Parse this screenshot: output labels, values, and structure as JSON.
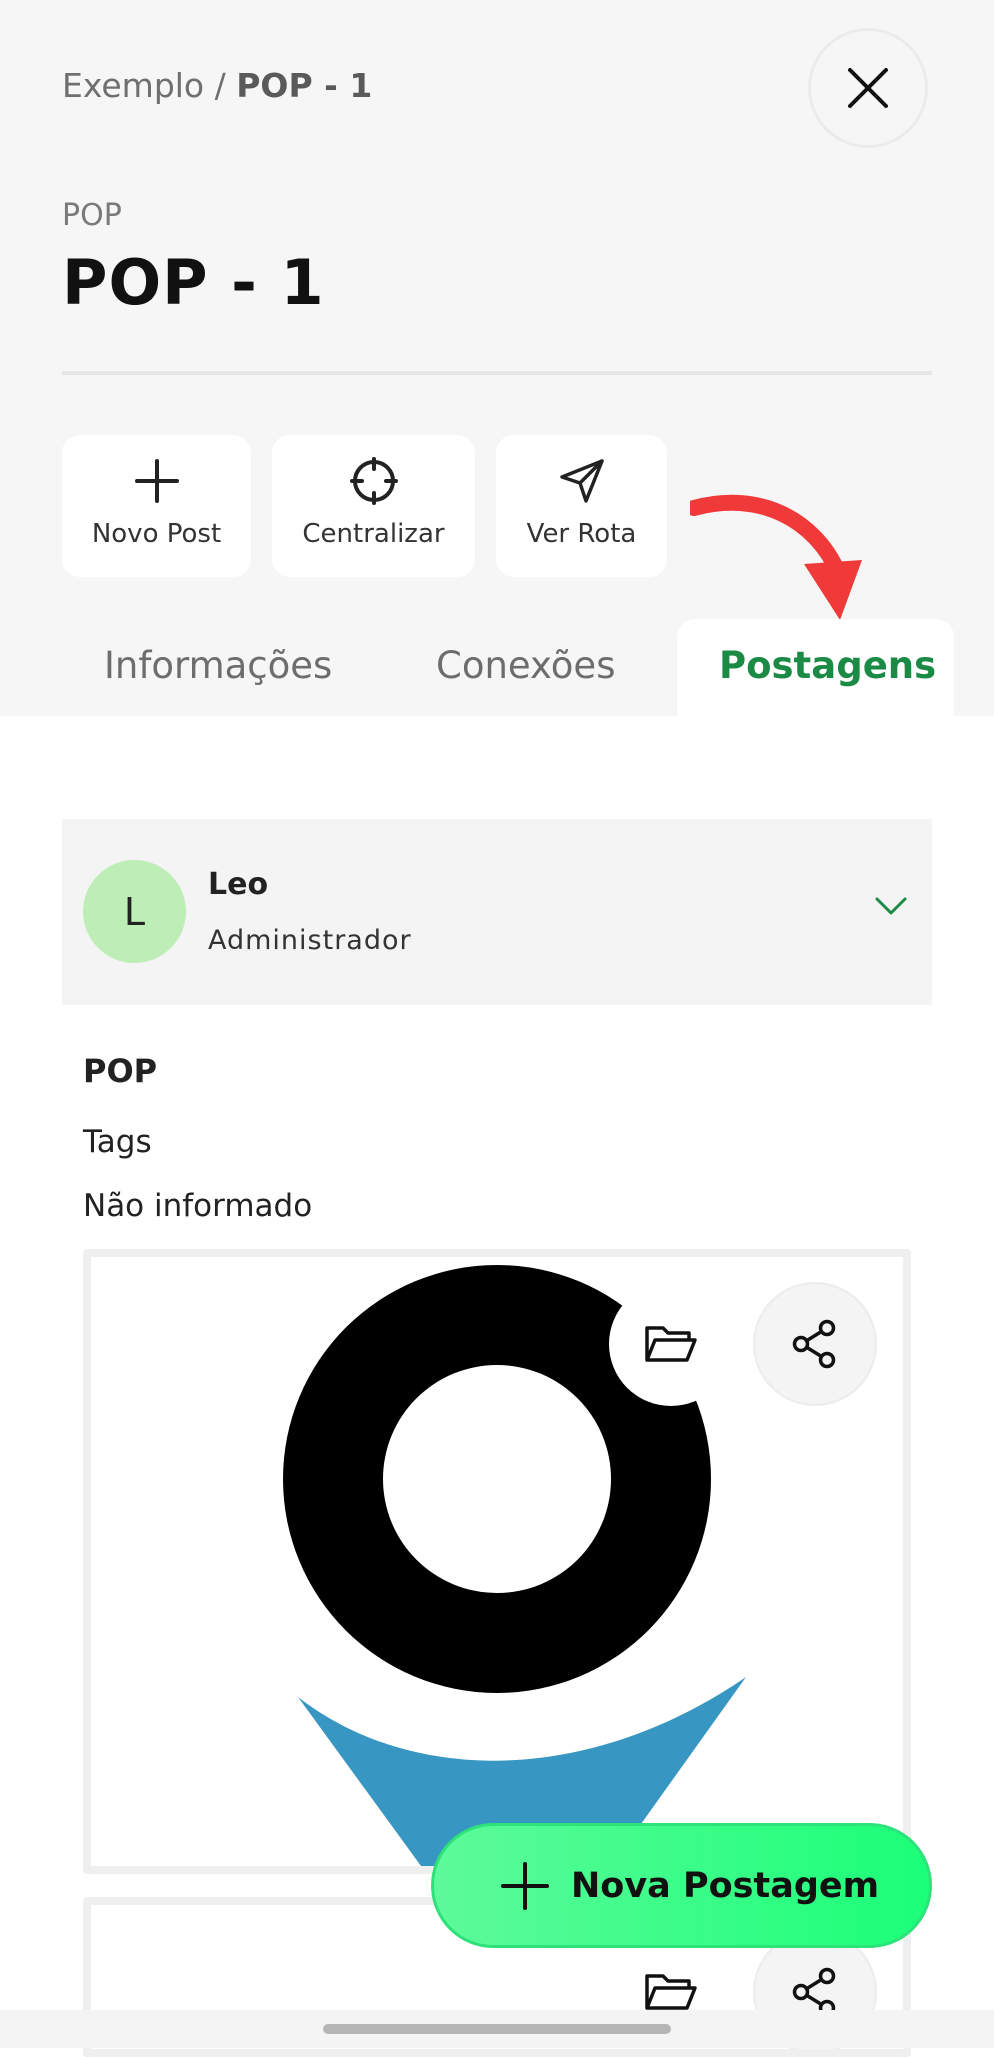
{
  "header": {
    "breadcrumb": {
      "parent": "Exemplo",
      "separator": " / ",
      "current": "POP - 1"
    },
    "close_icon": "close-icon"
  },
  "page": {
    "subtitle": "POP",
    "title": "POP - 1"
  },
  "actions": [
    {
      "label": "Novo Post",
      "icon": "plus-icon"
    },
    {
      "label": "Centralizar",
      "icon": "crosshair-icon"
    },
    {
      "label": "Ver Rota",
      "icon": "send-icon"
    }
  ],
  "tabs": [
    {
      "label": "Informações",
      "active": false
    },
    {
      "label": "Conexões",
      "active": false
    },
    {
      "label": "Postagens",
      "active": true
    }
  ],
  "post": {
    "author": {
      "initial": "L",
      "name": "Leo",
      "role": "Administrador"
    },
    "title": "POP",
    "tags_label": "Tags",
    "tags_value": "Não informado"
  },
  "fab": {
    "label": "Nova Postagem",
    "icon": "plus-icon"
  },
  "colors": {
    "accent": "#1b8a45",
    "fab": "#1bff78",
    "avatar": "#bdeeb6",
    "annotation_arrow": "#f03a3a",
    "pin_blue": "#3797c2"
  }
}
